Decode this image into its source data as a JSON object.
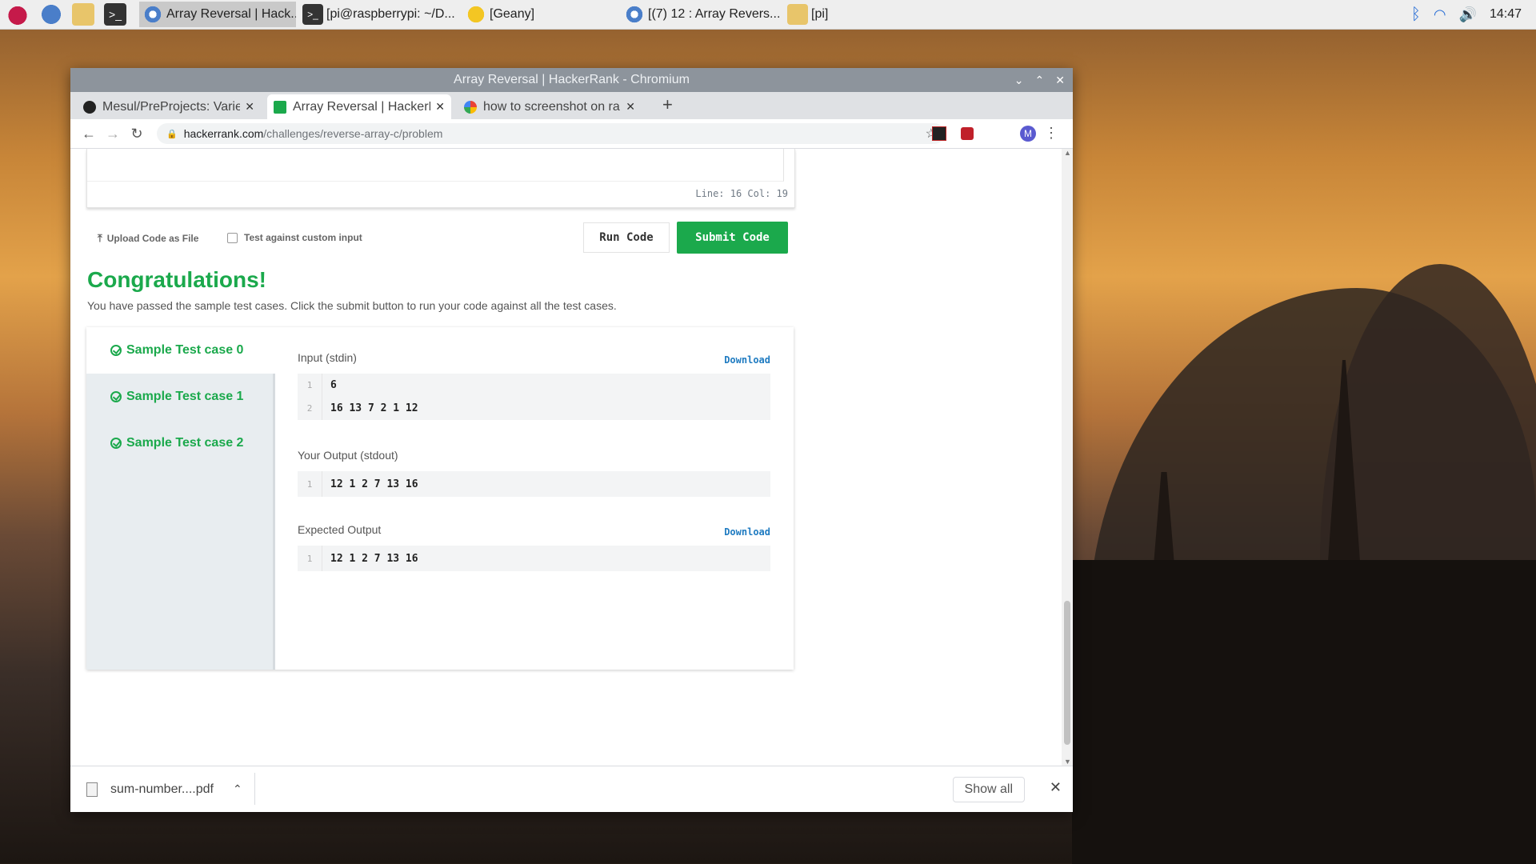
{
  "taskbar": {
    "tasks": [
      {
        "label": "Array Reversal | Hack...",
        "icon": "chromium-icon"
      },
      {
        "label": "[pi@raspberrypi: ~/D...",
        "icon": "terminal-icon"
      },
      {
        "label": "[Geany]",
        "icon": "geany-icon"
      },
      {
        "label": "[(7) 12 : Array Revers...",
        "icon": "chromium-icon"
      },
      {
        "label": "[pi]",
        "icon": "folder-icon"
      }
    ],
    "clock": "14:47"
  },
  "window": {
    "title": "Array Reversal | HackerRank - Chromium"
  },
  "tabs": [
    {
      "label": "Mesul/PreProjects: Varie",
      "close": "✕"
    },
    {
      "label": "Array Reversal | HackerR",
      "close": "✕"
    },
    {
      "label": "how to screenshot on ra",
      "close": "✕"
    }
  ],
  "new_tab": "+",
  "address": {
    "host": "hackerrank.com",
    "path": "/challenges/reverse-array-c/problem"
  },
  "profile_initial": "M",
  "editor": {
    "status": "Line: 16 Col: 19"
  },
  "actions": {
    "upload_label": "Upload Code as File",
    "custom_input_label": "Test against custom input",
    "run_label": "Run Code",
    "submit_label": "Submit Code"
  },
  "result": {
    "heading": "Congratulations!",
    "message": "You have passed the sample test cases. Click the submit button to run your code against all the test cases."
  },
  "test_cases": [
    {
      "label": "Sample Test case 0"
    },
    {
      "label": "Sample Test case 1"
    },
    {
      "label": "Sample Test case 2"
    }
  ],
  "panels": {
    "input": {
      "title": "Input (stdin)",
      "download": "Download",
      "lines": [
        {
          "num": "1",
          "text": "6"
        },
        {
          "num": "2",
          "text": "16 13 7 2 1 12"
        }
      ]
    },
    "output": {
      "title": "Your Output (stdout)",
      "lines": [
        {
          "num": "1",
          "text": "12 1 2 7 13 16"
        }
      ]
    },
    "expected": {
      "title": "Expected Output",
      "download": "Download",
      "lines": [
        {
          "num": "1",
          "text": "12 1 2 7 13 16"
        }
      ]
    }
  },
  "download_bar": {
    "file": "sum-number....pdf",
    "show_all": "Show all",
    "close": "✕"
  },
  "colors": {
    "accent_green": "#1ba94c",
    "link_blue": "#1f7bc1"
  }
}
